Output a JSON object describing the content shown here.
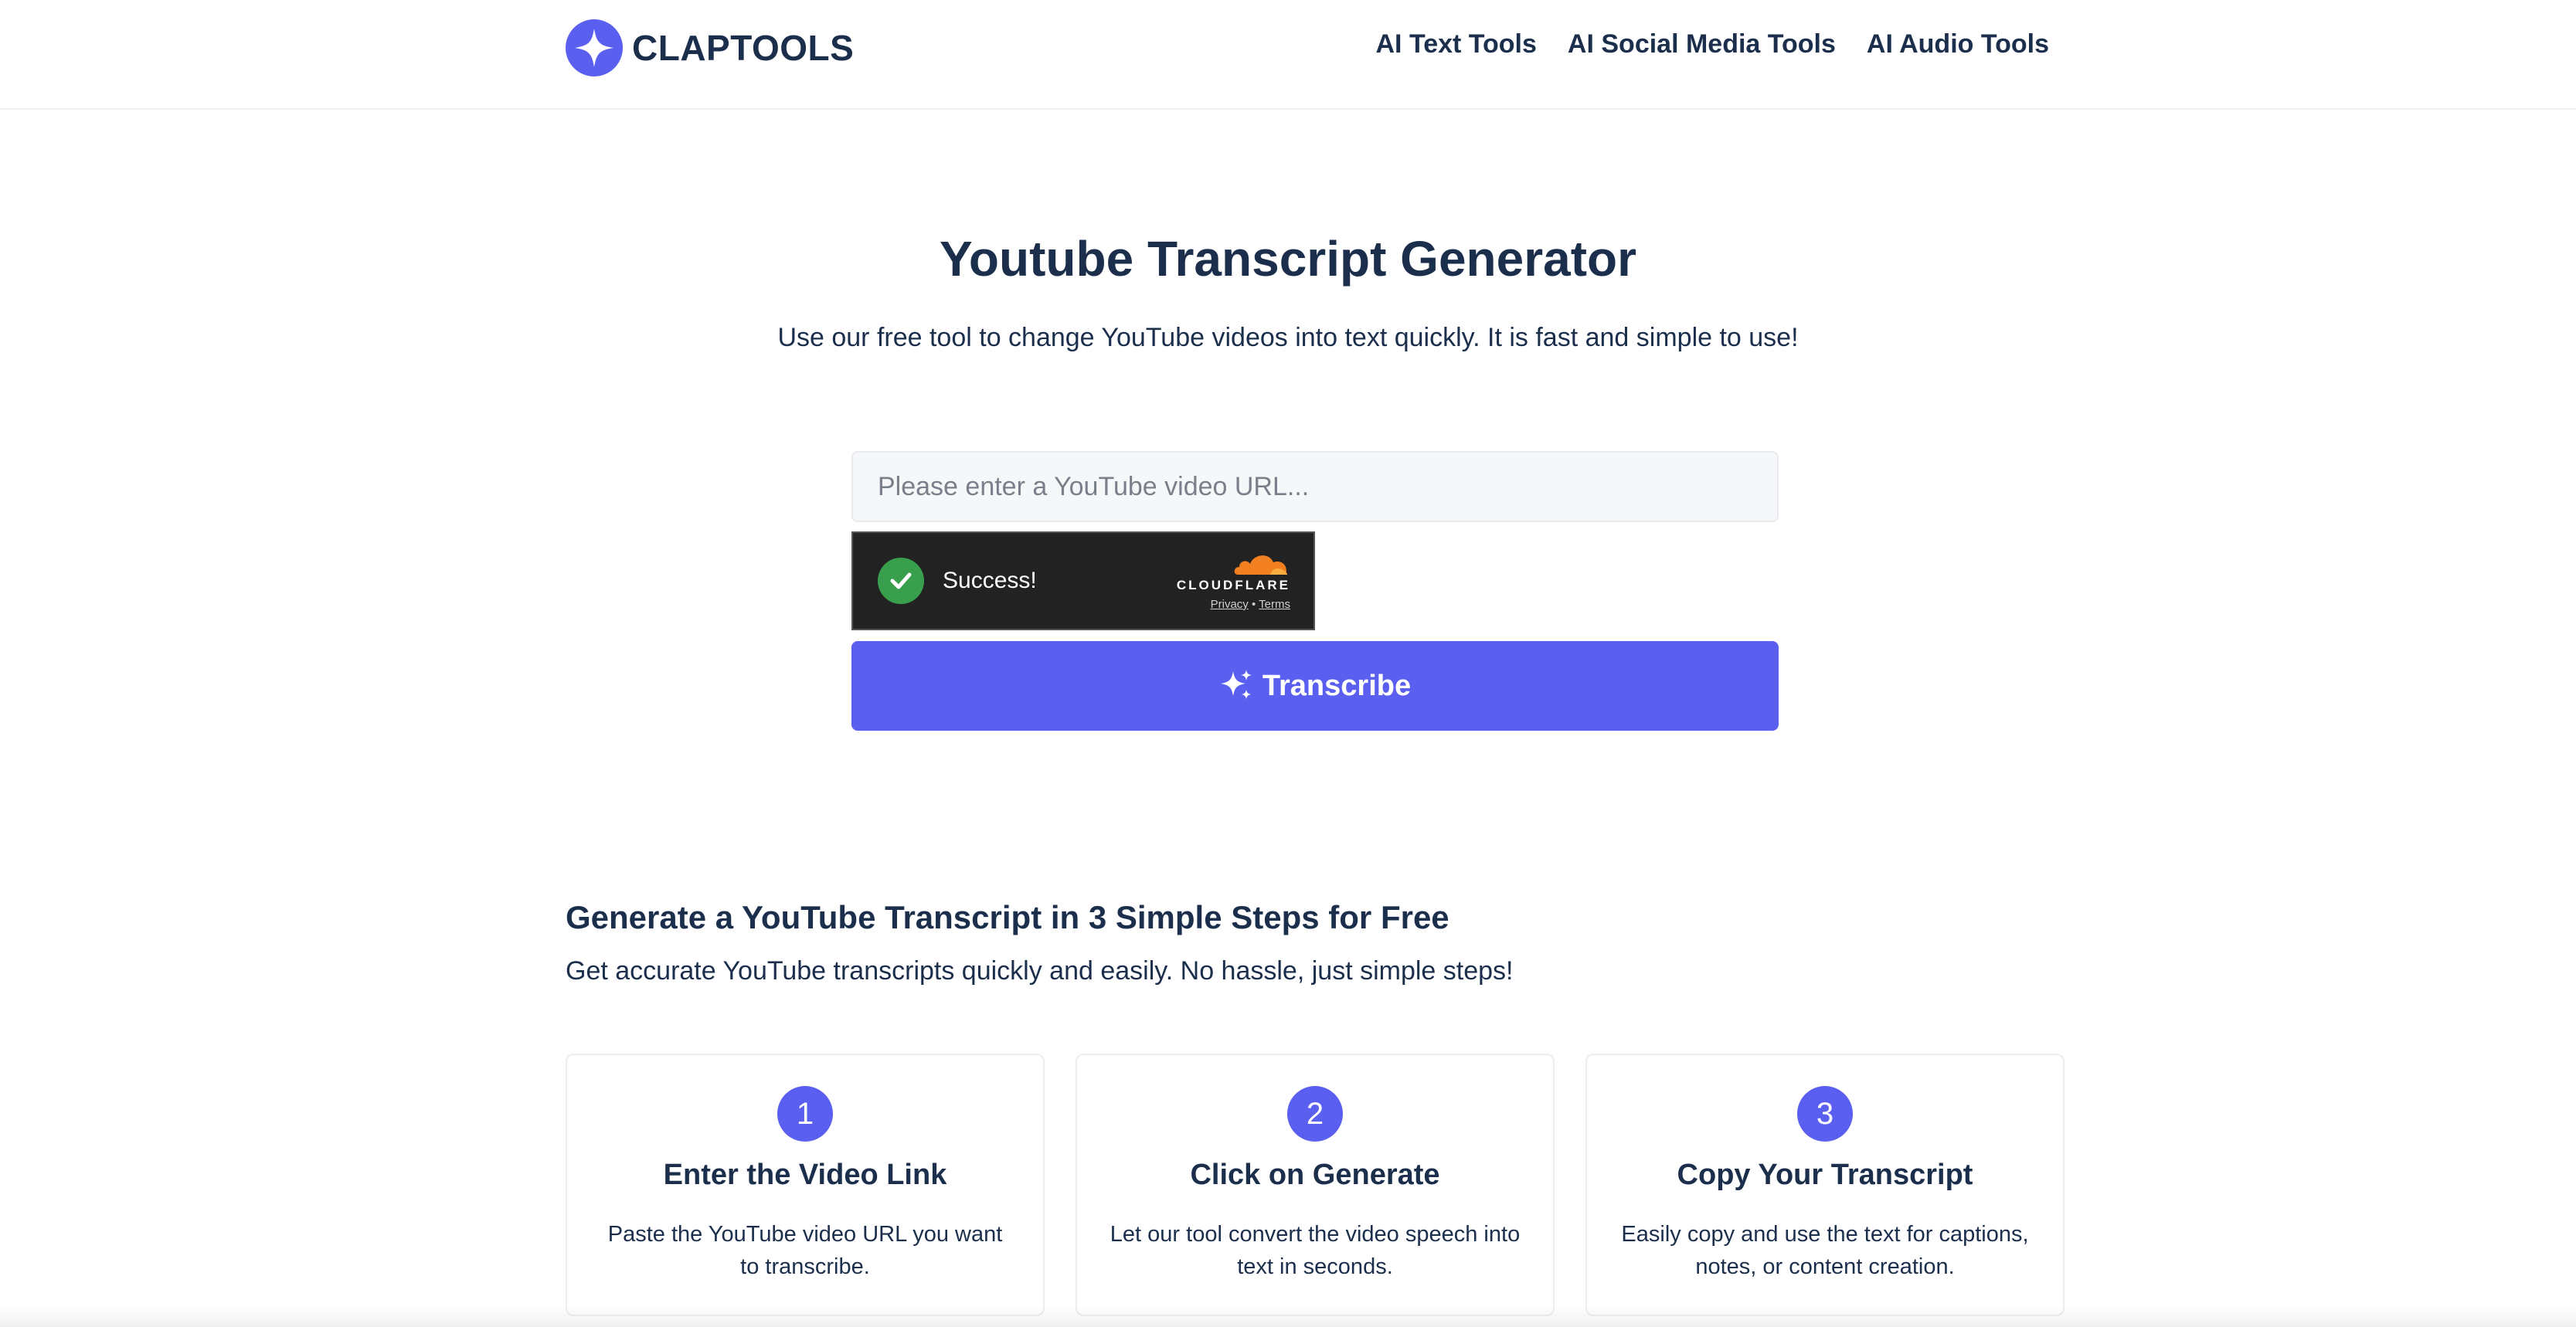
{
  "brand": {
    "name": "CLAPTOOLS",
    "color": "#5b5fef"
  },
  "nav": [
    {
      "label": "AI Text Tools"
    },
    {
      "label": "AI Social Media Tools"
    },
    {
      "label": "AI Audio Tools"
    }
  ],
  "hero": {
    "title": "Youtube Transcript Generator",
    "subtitle": "Use our free tool to change YouTube videos into text quickly. It is fast and simple to use!",
    "input_placeholder": "Please enter a YouTube video URL...",
    "input_value": ""
  },
  "captcha": {
    "status": "Success!",
    "provider": "CLOUDFLARE",
    "privacy": "Privacy",
    "separator": "•",
    "terms": "Terms",
    "check_color": "#38a04c",
    "cloud_color": "#f38020"
  },
  "transcribe_button": {
    "label": "Transcribe",
    "icon": "sparkles-icon"
  },
  "steps": {
    "title": "Generate a YouTube Transcript in 3 Simple Steps for Free",
    "subtitle": "Get accurate YouTube transcripts quickly and easily. No hassle, just simple steps!",
    "items": [
      {
        "number": "1",
        "title": "Enter the Video Link",
        "description": "Paste the YouTube video URL you want to transcribe."
      },
      {
        "number": "2",
        "title": "Click on Generate",
        "description": "Let our tool convert the video speech into text in seconds."
      },
      {
        "number": "3",
        "title": "Copy Your Transcript",
        "description": "Easily copy and use the text for captions, notes, or content creation."
      }
    ]
  }
}
